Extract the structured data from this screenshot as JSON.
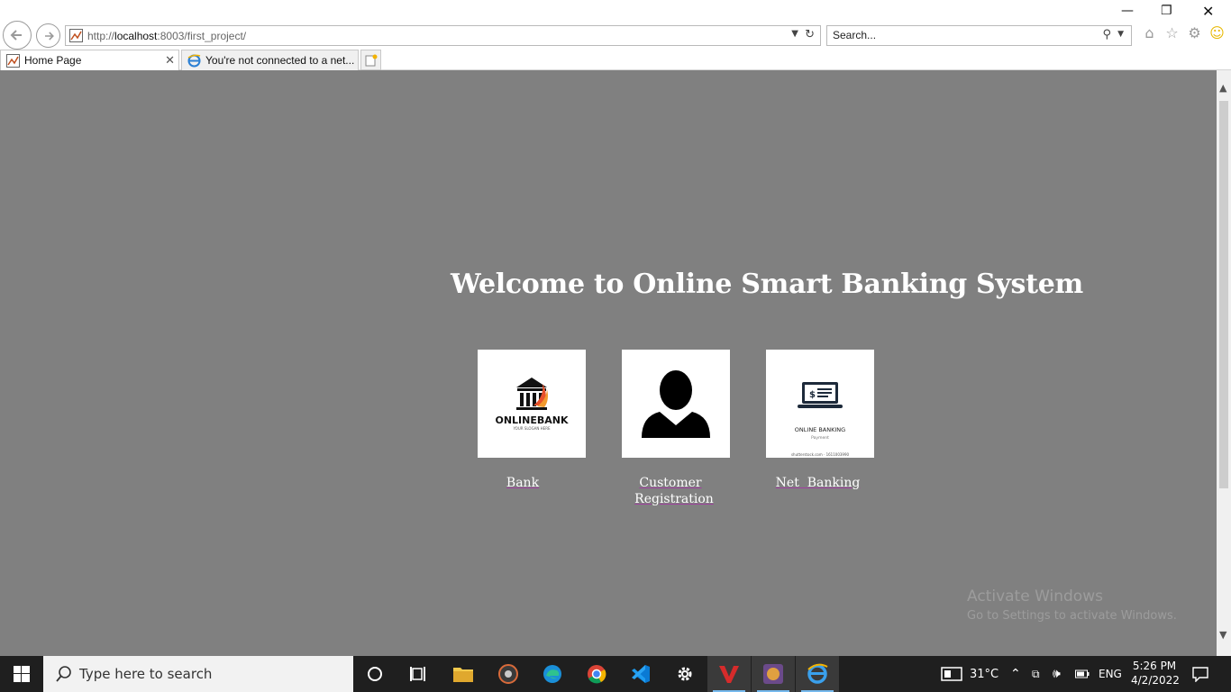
{
  "browser": {
    "url_prefix": "http://",
    "url_host": "localhost",
    "url_rest": ":8003/first_project/",
    "search_placeholder": "Search...",
    "tabs": [
      {
        "label": "Home Page"
      },
      {
        "label": "You're not connected to a net..."
      }
    ]
  },
  "page": {
    "heading": "Welcome to Online Smart Banking System",
    "cards": [
      {
        "label_line1": "Bank",
        "label_line2": ""
      },
      {
        "label_line1": "Customer",
        "label_line2": "Registration"
      },
      {
        "label_line1": "Net  Banking",
        "label_line2": ""
      }
    ],
    "bank_logo_text": "ONLINEBANK",
    "bank_logo_tagline": "YOUR SLOGAN HERE",
    "net_logo_text": "ONLINE BANKING",
    "net_logo_sub": "Payment",
    "net_logo_credit": "shutterstock.com · 1611003990"
  },
  "watermark": {
    "line1": "Activate Windows",
    "line2": "Go to Settings to activate Windows."
  },
  "taskbar": {
    "search_placeholder": "Type here to search",
    "weather": "31°C",
    "language": "ENG",
    "time": "5:26 PM",
    "date": "4/2/2022"
  },
  "colors": {
    "page_bg": "#808080",
    "taskbar_bg": "#1f1f1f",
    "link_underline": "#a040a0"
  }
}
